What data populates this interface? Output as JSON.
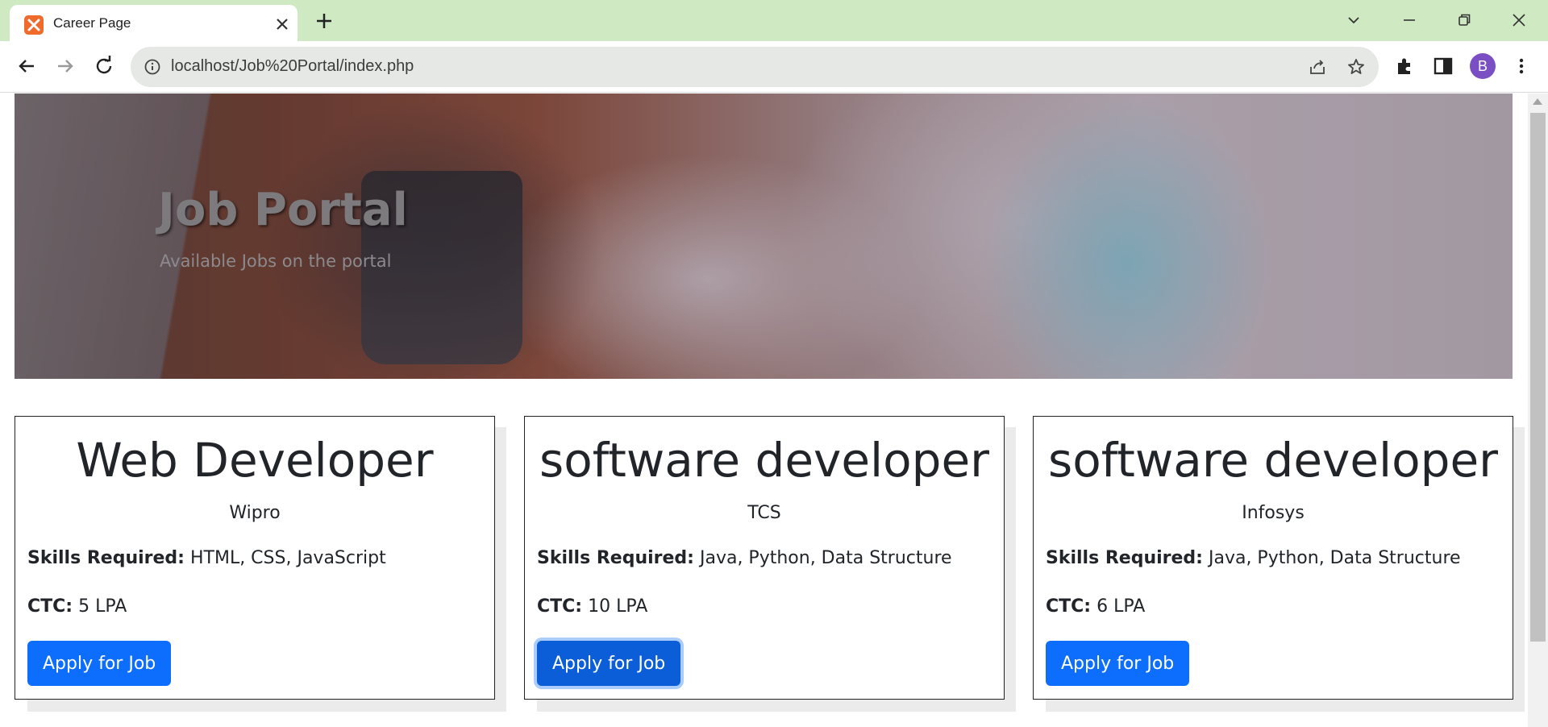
{
  "browser": {
    "tab": {
      "title": "Career Page",
      "favicon": "xampp-icon"
    },
    "url": "localhost/Job%20Portal/index.php",
    "profile_initial": "B",
    "colors": {
      "tab_strip": "#cfeac3",
      "avatar": "#7a4fc4"
    }
  },
  "hero": {
    "title": "Job Portal",
    "subtitle": "Available Jobs on the portal"
  },
  "jobs": [
    {
      "title": "Web Developer",
      "company": "Wipro",
      "skills_label": "Skills Required:",
      "skills": " HTML, CSS, JavaScript",
      "ctc_label": "CTC:",
      "ctc": " 5 LPA",
      "button": "Apply for Job"
    },
    {
      "title": "software developer",
      "company": "TCS",
      "skills_label": "Skills Required:",
      "skills": " Java, Python, Data Structure",
      "ctc_label": "CTC:",
      "ctc": " 10 LPA",
      "button": "Apply for Job"
    },
    {
      "title": "software developer",
      "company": "Infosys",
      "skills_label": "Skills Required:",
      "skills": " Java, Python, Data Structure",
      "ctc_label": "CTC:",
      "ctc": " 6 LPA",
      "button": "Apply for Job"
    }
  ],
  "colors": {
    "primary_button": "#0d6efd",
    "text": "#212529"
  }
}
